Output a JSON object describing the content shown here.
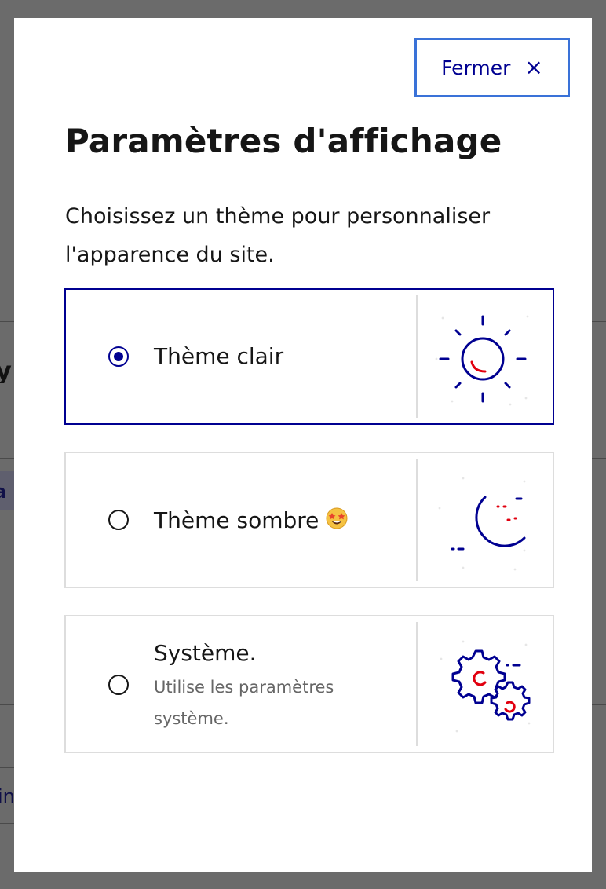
{
  "modal": {
    "close_label": "Fermer",
    "close_icon": "×",
    "title": "Paramètres d'affichage",
    "description": "Choisissez un thème pour personnaliser l'apparence du site."
  },
  "options": [
    {
      "label": "Thème clair",
      "selected": true,
      "icon": "sun-pictogram"
    },
    {
      "label": "Thème sombre",
      "selected": false,
      "icon": "moon-pictogram",
      "emoji": "star-struck-emoji"
    },
    {
      "label": "Système.",
      "hint": "Utilise les paramètres système.",
      "selected": false,
      "icon": "gears-pictogram"
    }
  ],
  "background": {
    "fragment_letter_1": "y",
    "fragment_letter_2": "a",
    "fragment_letter_3": "in"
  },
  "colors": {
    "primary": "#000091",
    "accent_red": "#e1000f",
    "focus_outline": "#3a72d8",
    "border": "#dddddd"
  }
}
